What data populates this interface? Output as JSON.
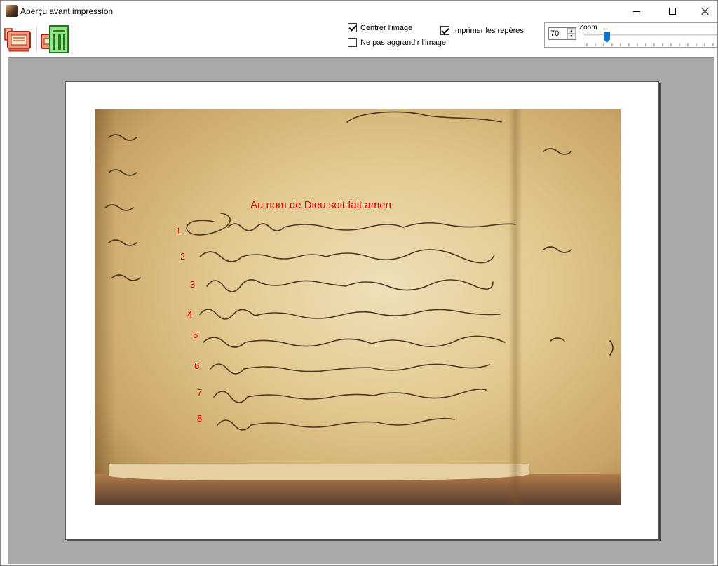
{
  "window": {
    "title": "Aperçu avant impression"
  },
  "toolbar": {
    "print_icon": "printer-icon",
    "print_setup_icon": "print-setup-icon",
    "center_image_label": "Centrer l'image",
    "center_image_checked": true,
    "no_enlarge_label": "Ne pas aggrandir l'image",
    "no_enlarge_checked": false,
    "print_marks_label": "Imprimer les repères",
    "print_marks_checked": true,
    "zoom_label": "Zoom",
    "zoom_value": "70"
  },
  "preview": {
    "header_text": "Au nom de Dieu soit fait amen",
    "line_numbers": [
      "1",
      "2",
      "3",
      "4",
      "5",
      "6",
      "7",
      "8"
    ]
  },
  "colors": {
    "annotation": "#e60000",
    "preview_background": "#a9a9a9",
    "slider_thumb": "#0078d7"
  }
}
